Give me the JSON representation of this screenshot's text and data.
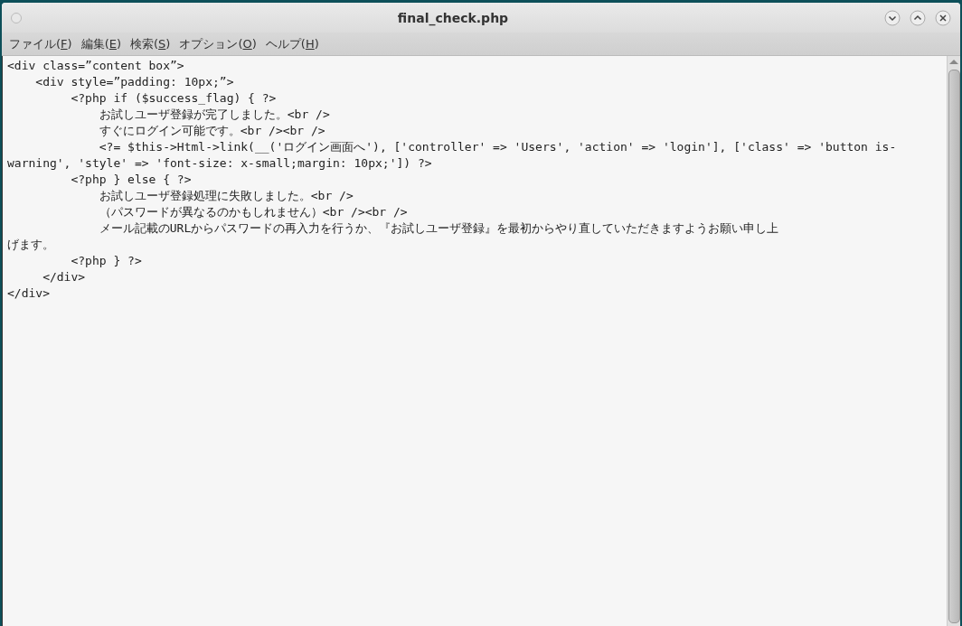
{
  "window": {
    "title": "final_check.php"
  },
  "menu": [
    {
      "before": "ファイル(",
      "key": "F",
      "after": ")"
    },
    {
      "before": "編集(",
      "key": "E",
      "after": ")"
    },
    {
      "before": "検索(",
      "key": "S",
      "after": ")"
    },
    {
      "before": "オプション(",
      "key": "O",
      "after": ")"
    },
    {
      "before": "ヘルプ(",
      "key": "H",
      "after": ")"
    }
  ],
  "editor": {
    "lines": [
      "<div class=”content box”>",
      "    <div style=”padding: 10px;”>",
      "         <?php if ($success_flag) { ?>",
      "             お試しユーザ登録が完了しました。<br />",
      "             すぐにログイン可能です。<br /><br />",
      "             <?= $this->Html->link(__('ログイン画面へ'), ['controller' => 'Users', 'action' => 'login'], ['class' => 'button is-",
      "warning', 'style' => 'font-size: x-small;margin: 10px;']) ?>",
      "         <?php } else { ?>",
      "             お試しユーザ登録処理に失敗しました。<br />",
      "             （パスワードが異なるのかもしれません）<br /><br />",
      "             メール記載のURLからパスワードの再入力を行うか、『お試しユーザ登録』を最初からやり直していただきますようお願い申し上",
      "げます。",
      "         <?php } ?>",
      "     </div>",
      "</div>"
    ]
  }
}
